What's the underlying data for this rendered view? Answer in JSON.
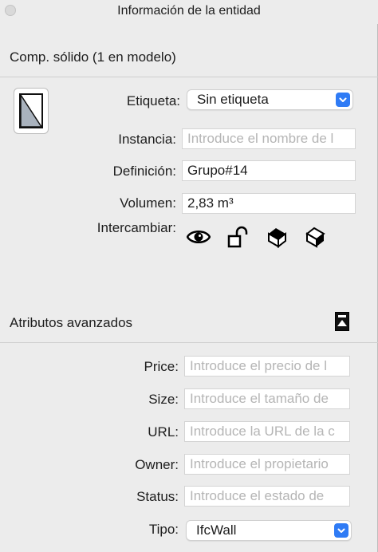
{
  "window": {
    "title": "Información de la entidad"
  },
  "entity": {
    "heading": "Comp. sólido (1 en modelo)",
    "etiqueta_label": "Etiqueta:",
    "etiqueta_value": "Sin etiqueta",
    "instancia_label": "Instancia:",
    "instancia_placeholder": "Introduce el nombre de l",
    "definicion_label": "Definición:",
    "definicion_value": "Grupo#14",
    "volumen_label": "Volumen:",
    "volumen_value": "2,83 m³",
    "intercambiar_label": "Intercambiar:",
    "toggle_icons": [
      "eye-icon",
      "lock-icon",
      "receive-shadows-icon",
      "cast-shadows-icon"
    ]
  },
  "advanced": {
    "heading": "Atributos avanzados",
    "price_label": "Price:",
    "price_placeholder": "Introduce el precio de l",
    "size_label": "Size:",
    "size_placeholder": "Introduce el tamaño de",
    "url_label": "URL:",
    "url_placeholder": "Introduce la URL de la c",
    "owner_label": "Owner:",
    "owner_placeholder": "Introduce el propietario",
    "status_label": "Status:",
    "status_placeholder": "Introduce el estado de",
    "tipo_label": "Tipo:",
    "tipo_value": "IfcWall"
  },
  "colors": {
    "accent": "#2f7bf5",
    "background": "#ececec"
  }
}
